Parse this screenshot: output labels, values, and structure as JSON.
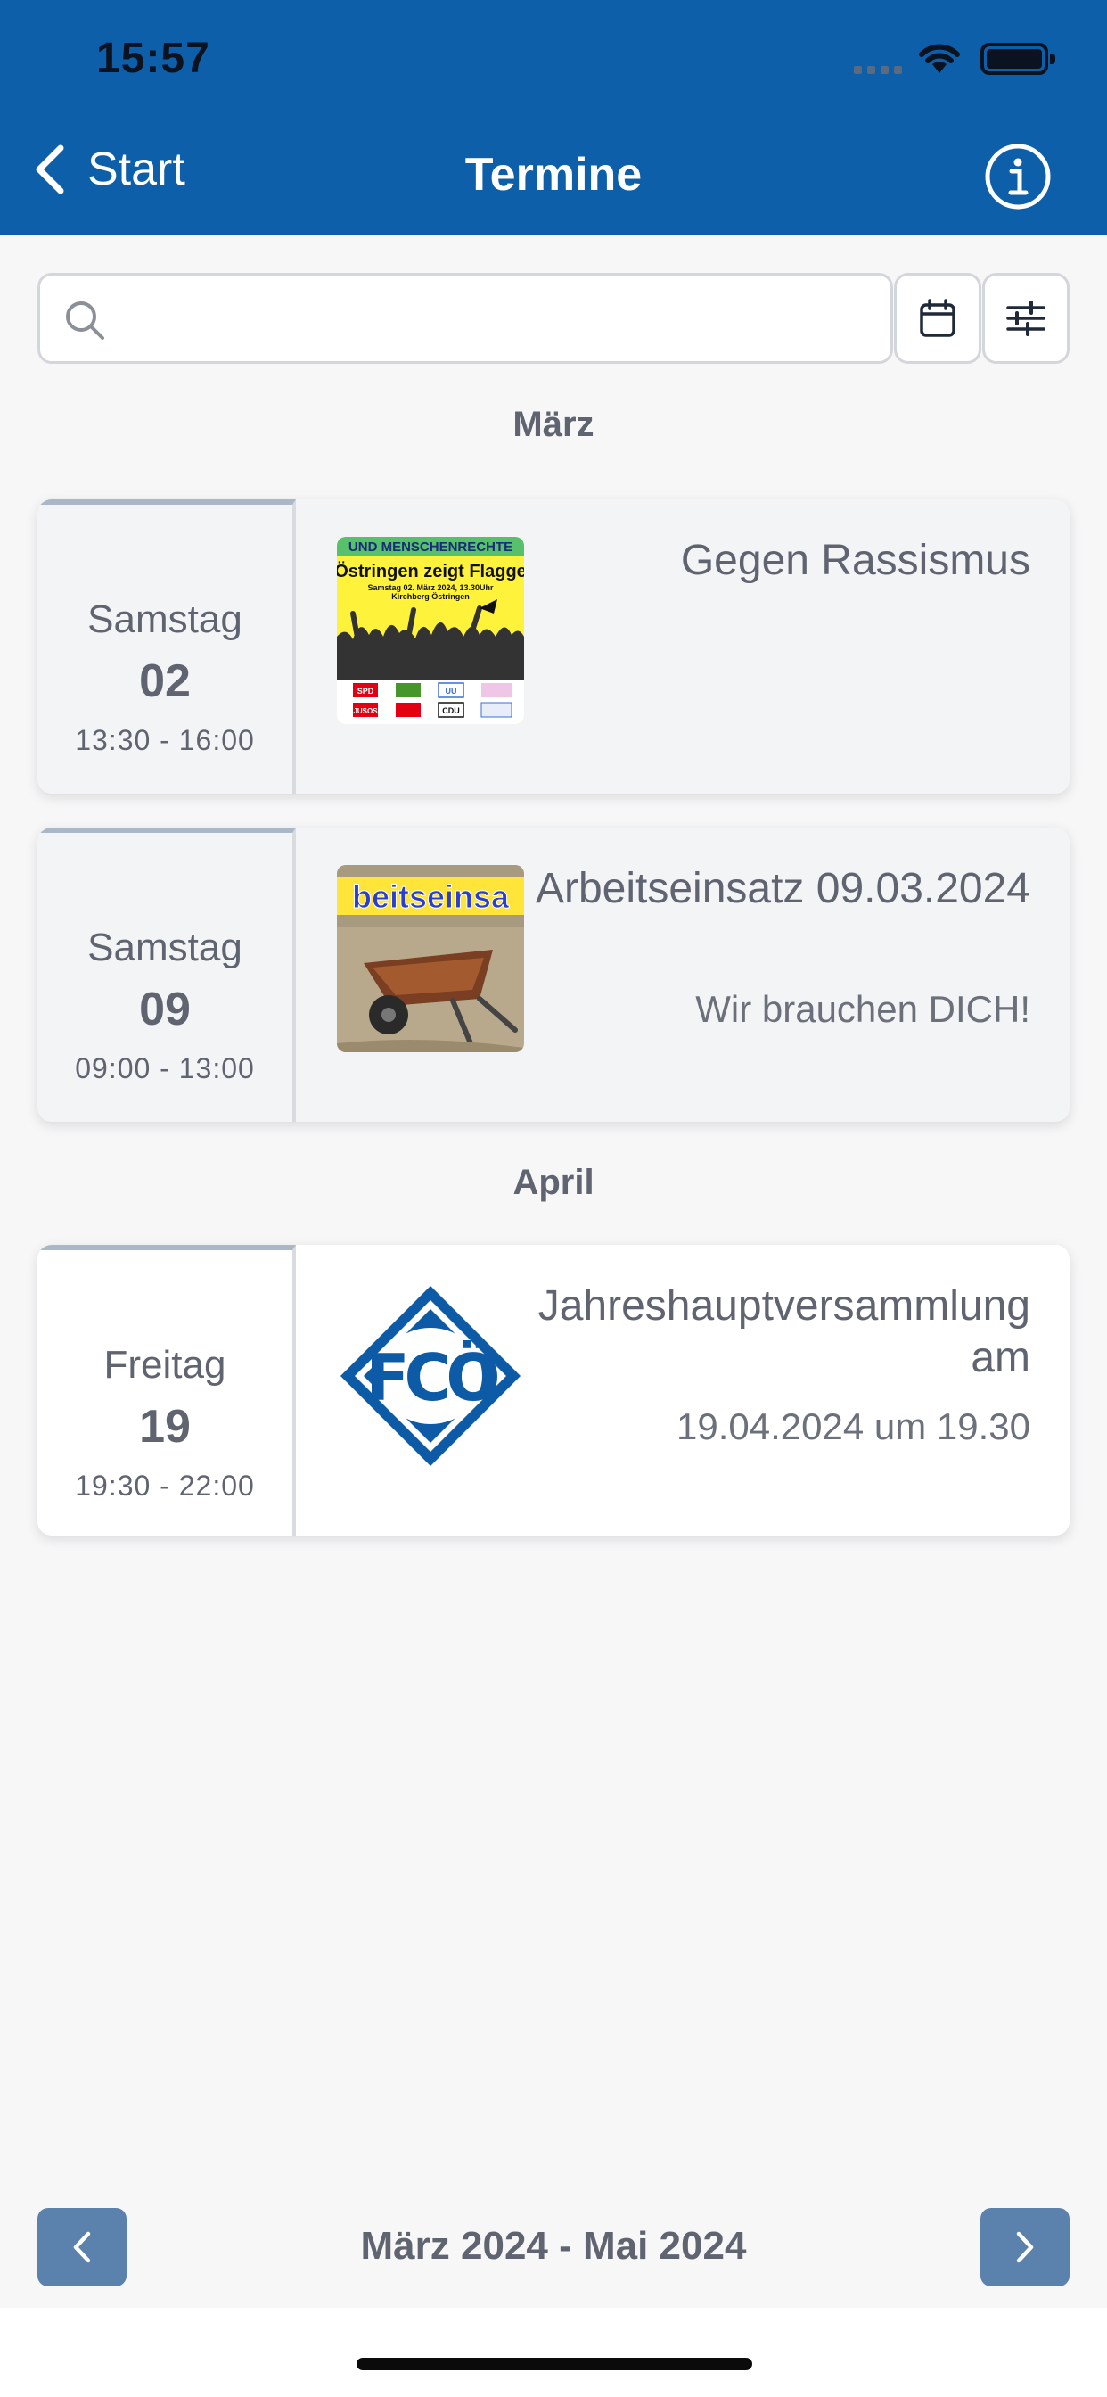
{
  "status_bar": {
    "time": "15:57"
  },
  "nav": {
    "back_label": "Start",
    "title": "Termine"
  },
  "search": {
    "placeholder": ""
  },
  "sections": [
    {
      "label": "März",
      "events": [
        {
          "weekday": "Samstag",
          "day": "02",
          "time": "13:30 - 16:00",
          "title": "Gegen Rassismus",
          "subtitle": ""
        },
        {
          "weekday": "Samstag",
          "day": "09",
          "time": "09:00 - 13:00",
          "title": "Arbeitseinsatz 09.03.2024",
          "subtitle": "Wir brauchen DICH!"
        }
      ]
    },
    {
      "label": "April",
      "events": [
        {
          "weekday": "Freitag",
          "day": "19",
          "time": "19:30 - 22:00",
          "title": "Jahreshauptversammlung am",
          "subtitle": "19.04.2024 um 19.30"
        }
      ]
    }
  ],
  "poster": {
    "banner": "UND MENSCHENRECHTE",
    "headline": "Östringen zeigt Flagge",
    "details_line1": "Samstag 02. März 2024, 13.30Uhr",
    "details_line2": "Kirchberg Östringen",
    "logos": [
      "SPD",
      "",
      "UU",
      "",
      "JUSOS",
      "",
      "CDU",
      ""
    ]
  },
  "work_image": {
    "banner_text": "beitseinsa"
  },
  "club_logo": {
    "text": "FCÖ"
  },
  "pager": {
    "label": "März 2024 - Mai 2024"
  },
  "colors": {
    "header": "#0c5fa8",
    "pager_button": "#5b82ad",
    "date_border": "#a9b7c8",
    "club_blue": "#0d5ba6"
  }
}
